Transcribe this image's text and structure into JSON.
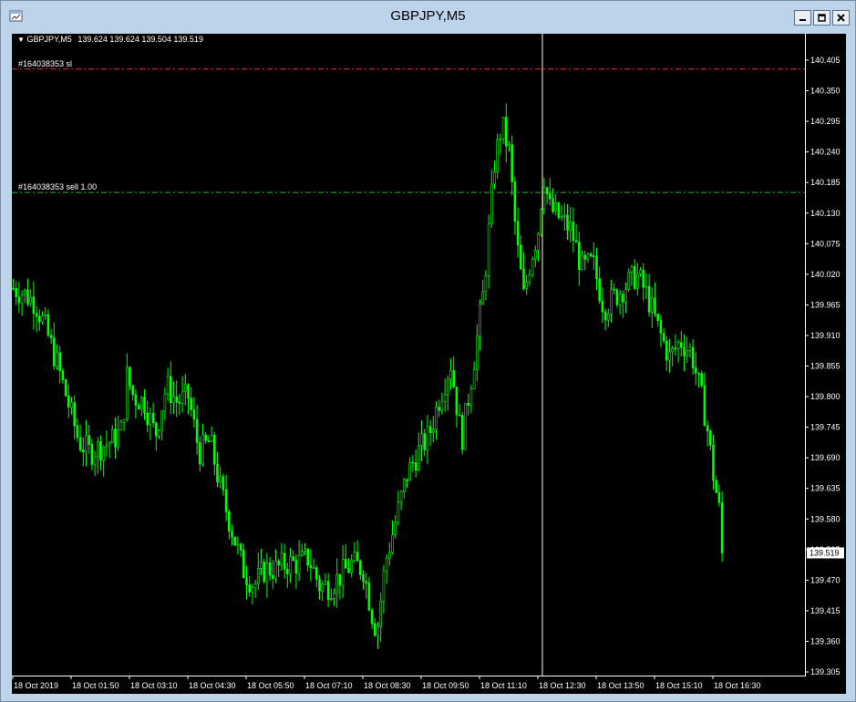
{
  "window": {
    "title": "GBPJPY,M5",
    "controls": [
      "minimize-icon",
      "restore-icon",
      "close-icon"
    ]
  },
  "chart": {
    "symbol_header": "GBPJPY,M5",
    "ohlc_text": "139.624 139.624 139.504 139.519",
    "current_price_label": "139.519"
  },
  "levels": {
    "sl_label": "#164038353 sl",
    "sell_label": "#164038353 sell 1.00"
  },
  "colors": {
    "background": "#000000",
    "candle": "#00ff00",
    "sl_line": "#ff2a2a",
    "entry_line": "#18c018",
    "crosshair": "#ffffc8",
    "axis_text": "#ffffff"
  },
  "chart_data": {
    "type": "candlestick",
    "symbol": "GBPJPY",
    "timeframe": "M5",
    "y_ticks": [
      "140.405",
      "140.350",
      "140.295",
      "140.240",
      "140.185",
      "140.130",
      "140.075",
      "140.020",
      "139.965",
      "139.910",
      "139.855",
      "139.800",
      "139.745",
      "139.690",
      "139.635",
      "139.580",
      "139.525",
      "139.470",
      "139.415",
      "139.360",
      "139.305"
    ],
    "ylim": [
      139.305,
      140.405
    ],
    "x_ticks": [
      "18 Oct 2019",
      "18 Oct 01:50",
      "18 Oct 03:10",
      "18 Oct 04:30",
      "18 Oct 05:50",
      "18 Oct 07:10",
      "18 Oct 08:30",
      "18 Oct 09:50",
      "18 Oct 11:10",
      "18 Oct 12:30",
      "18 Oct 13:50",
      "18 Oct 15:10",
      "18 Oct 16:30"
    ],
    "last_price": 139.519,
    "stop_loss_price": 140.389,
    "sell_entry_price": 140.167,
    "close_path": [
      [
        0,
        139.995
      ],
      [
        12,
        139.985
      ],
      [
        24,
        139.97
      ],
      [
        36,
        139.92
      ],
      [
        48,
        139.86
      ],
      [
        60,
        139.79
      ],
      [
        72,
        139.72
      ],
      [
        84,
        139.7
      ],
      [
        96,
        139.71
      ],
      [
        108,
        139.72
      ],
      [
        120,
        139.74
      ],
      [
        124,
        139.84
      ],
      [
        132,
        139.8
      ],
      [
        144,
        139.79
      ],
      [
        156,
        139.73
      ],
      [
        168,
        139.82
      ],
      [
        180,
        139.79
      ],
      [
        192,
        139.8
      ],
      [
        204,
        139.7
      ],
      [
        216,
        139.72
      ],
      [
        228,
        139.63
      ],
      [
        240,
        139.56
      ],
      [
        252,
        139.49
      ],
      [
        264,
        139.46
      ],
      [
        276,
        139.49
      ],
      [
        288,
        139.49
      ],
      [
        300,
        139.5
      ],
      [
        312,
        139.5
      ],
      [
        324,
        139.51
      ],
      [
        336,
        139.46
      ],
      [
        348,
        139.46
      ],
      [
        360,
        139.48
      ],
      [
        372,
        139.5
      ],
      [
        384,
        139.49
      ],
      [
        396,
        139.39
      ],
      [
        400,
        139.39
      ],
      [
        408,
        139.5
      ],
      [
        420,
        139.58
      ],
      [
        432,
        139.66
      ],
      [
        444,
        139.7
      ],
      [
        456,
        139.73
      ],
      [
        468,
        139.8
      ],
      [
        480,
        139.86
      ],
      [
        492,
        139.72
      ],
      [
        504,
        139.85
      ],
      [
        516,
        139.99
      ],
      [
        528,
        140.22
      ],
      [
        536,
        140.29
      ],
      [
        544,
        140.24
      ],
      [
        552,
        140.08
      ],
      [
        560,
        139.98
      ],
      [
        568,
        140.05
      ],
      [
        576,
        140.1
      ],
      [
        582,
        140.2
      ],
      [
        588,
        140.14
      ],
      [
        600,
        140.12
      ],
      [
        612,
        140.1
      ],
      [
        624,
        140.03
      ],
      [
        636,
        140.04
      ],
      [
        648,
        139.96
      ],
      [
        660,
        139.98
      ],
      [
        672,
        140.0
      ],
      [
        684,
        140.02
      ],
      [
        696,
        139.98
      ],
      [
        708,
        139.92
      ],
      [
        720,
        139.87
      ],
      [
        732,
        139.9
      ],
      [
        744,
        139.88
      ],
      [
        752,
        139.82
      ],
      [
        760,
        139.76
      ],
      [
        768,
        139.66
      ],
      [
        776,
        139.58
      ],
      [
        778,
        139.519
      ]
    ]
  }
}
